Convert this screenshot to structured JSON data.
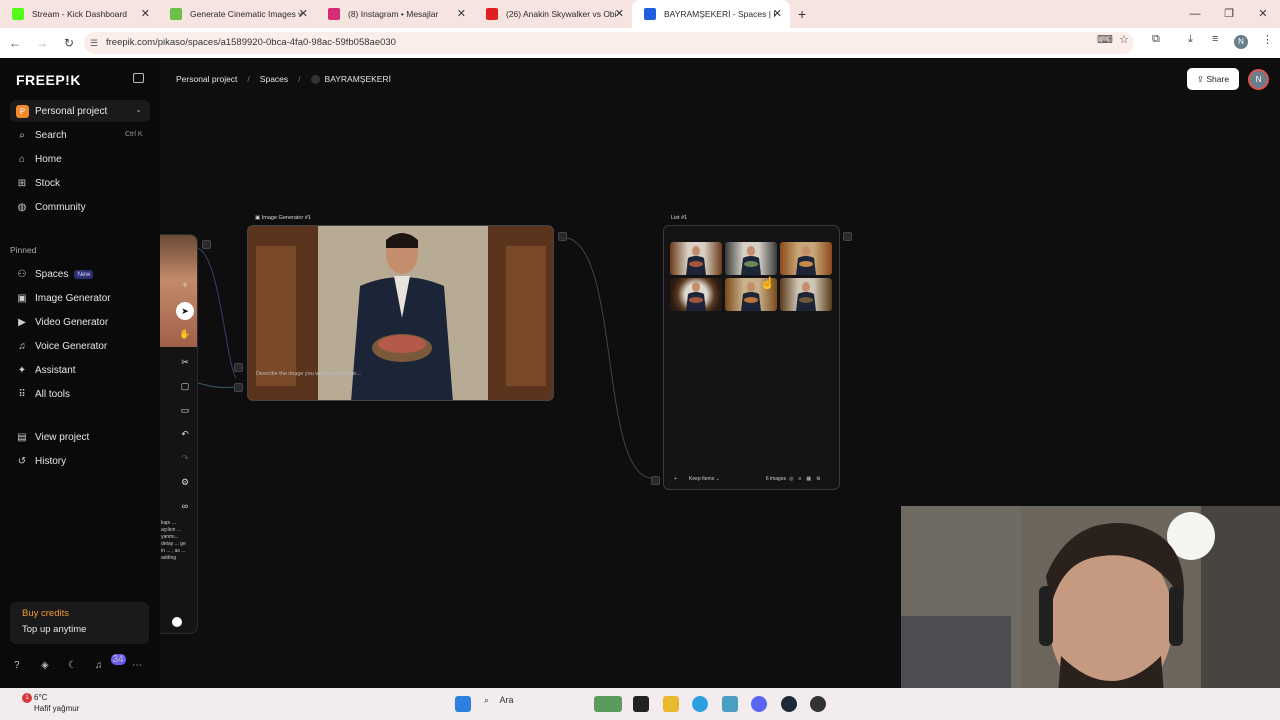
{
  "browser": {
    "tabs": [
      {
        "label": "Stream - Kick Dashboard",
        "color": "#53fc18"
      },
      {
        "label": "Generate Cinematic Images wit",
        "color": "#6cc04a"
      },
      {
        "label": "(8) Instagram • Mesajlar",
        "color": "#d62976"
      },
      {
        "label": "(26) Anakin Skywalker vs Obi W",
        "color": "#e02020"
      },
      {
        "label": "BAYRAMŞEKERİ - Spaces | Freep",
        "color": "#2060e0"
      }
    ],
    "new_tab": "+",
    "url": "freepik.com/pikaso/spaces/a1589920-0bca-4fa0-98ac-59fb058ae030",
    "profile_initial": "N"
  },
  "sidebar": {
    "logo": "FREEP!K",
    "project": {
      "initial": "P",
      "label": "Personal project"
    },
    "search": {
      "label": "Search",
      "shortcut": "Ctrl K"
    },
    "items": [
      {
        "label": "Home",
        "icon": "⌂"
      },
      {
        "label": "Stock",
        "icon": "⊞"
      },
      {
        "label": "Community",
        "icon": "◍"
      }
    ],
    "pinned_heading": "Pinned",
    "pinned": [
      {
        "label": "Spaces",
        "icon": "⚇",
        "badge": "New"
      },
      {
        "label": "Image Generator",
        "icon": "▣"
      },
      {
        "label": "Video Generator",
        "icon": "▶"
      },
      {
        "label": "Voice Generator",
        "icon": "♫"
      },
      {
        "label": "Assistant",
        "icon": "✦"
      },
      {
        "label": "All tools",
        "icon": "⠿"
      }
    ],
    "project_items": [
      {
        "label": "View project",
        "icon": "▤"
      },
      {
        "label": "History",
        "icon": "↺"
      }
    ],
    "credits": {
      "title": "Buy credits",
      "subtitle": "Top up anytime"
    },
    "notifications": "34"
  },
  "header": {
    "breadcrumb": [
      "Personal project",
      "Spaces",
      "BAYRAMŞEKERİ"
    ],
    "share": "Share",
    "avatar": "N"
  },
  "canvas": {
    "image_node": {
      "label": "Image Generator #1",
      "prompt_placeholder": "Describe the image you want to generate..."
    },
    "list_node": {
      "label": "List #1",
      "footer_action": "Keep Items",
      "count": "6 images"
    },
    "left_card_text": "kapı ... açılsın ... yanmı... detay ... ge in ... , as ... adding"
  },
  "taskbar": {
    "weather_temp": "6°C",
    "weather_desc": "Hafif yağmur",
    "weather_badge": "1",
    "search": "Ara"
  }
}
